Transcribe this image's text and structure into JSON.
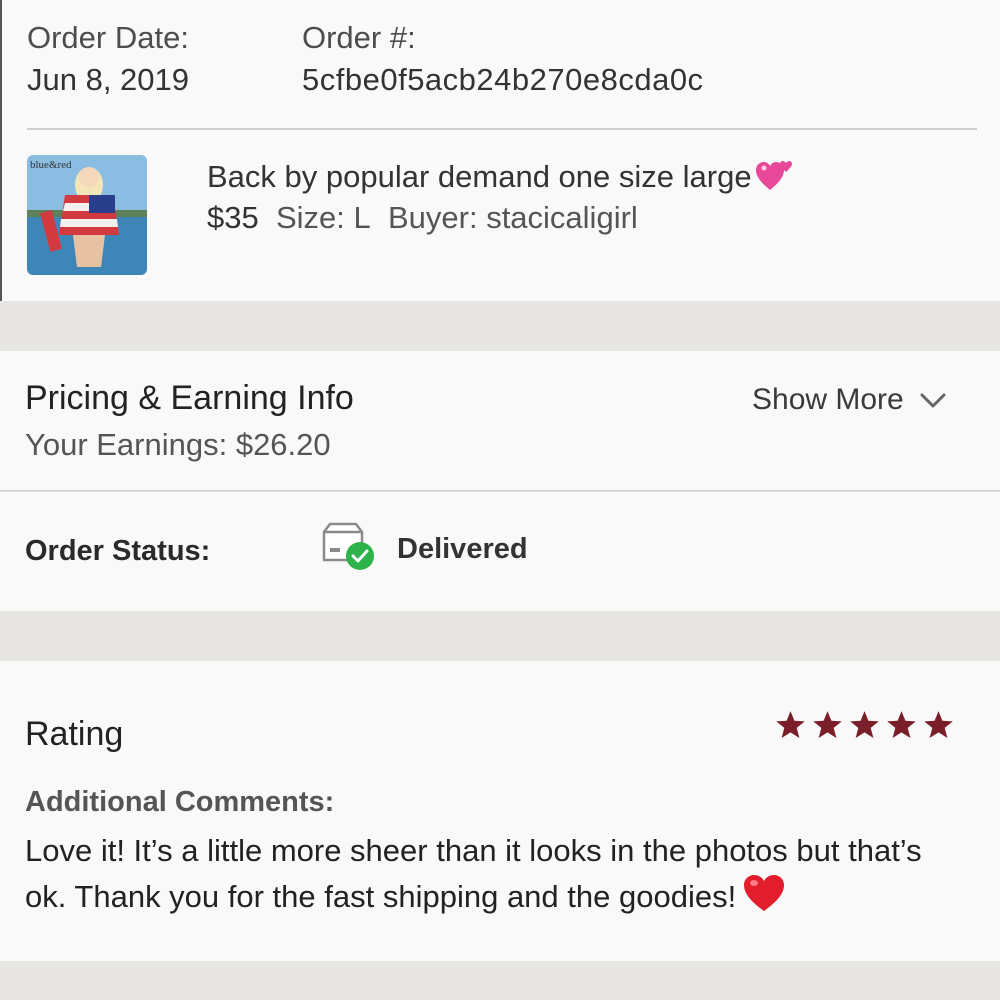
{
  "order": {
    "date_label": "Order Date:",
    "date_value": "Jun 8, 2019",
    "number_label": "Order #:",
    "number_value": "5cfbe0f5acb24b270e8cda0c"
  },
  "item": {
    "thumbnail_caption": "blue&red",
    "title": "Back by popular demand one size large",
    "title_emoji": "sparkling-heart-icon",
    "price": "$35",
    "size": "Size: L",
    "buyer": "Buyer: stacicaligirl"
  },
  "pricing": {
    "title": "Pricing & Earning Info",
    "earnings": "Your Earnings: $26.20",
    "show_more": "Show More"
  },
  "status": {
    "label": "Order Status:",
    "value": "Delivered",
    "icon": "delivered-box-check-icon"
  },
  "rating": {
    "title": "Rating",
    "stars": 5,
    "star_color": "#7a1f2a",
    "comments_label": "Additional Comments:",
    "comment": "Love it! It’s a little more sheer than it looks in the photos but that’s ok. Thank you for the fast shipping and the goodies!",
    "comment_emoji": "red-heart-icon"
  },
  "colors": {
    "background": "#e8e6e2",
    "card": "#faf9fa",
    "check_green": "#2eb24a"
  }
}
